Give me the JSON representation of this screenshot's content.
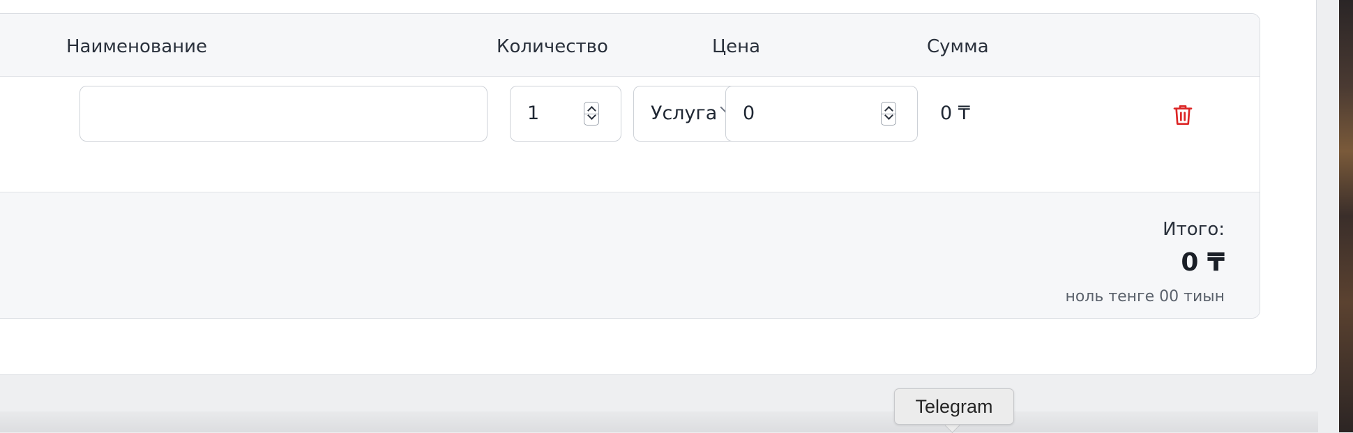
{
  "table": {
    "headers": {
      "name": "Наименование",
      "quantity": "Количество",
      "price": "Цена",
      "sum": "Сумма"
    },
    "rows": [
      {
        "name": "",
        "quantity": "1",
        "unit": "Услуга",
        "price": "0",
        "sum": "0 ₸"
      }
    ]
  },
  "totals": {
    "label": "Итого:",
    "value": "0 ₸",
    "in_words": "ноль тенге 00 тиын"
  },
  "dock": {
    "tooltip": "Telegram"
  },
  "colors": {
    "delete_icon": "#dc2626",
    "header_background": "#f6f7f9",
    "border": "#d9dce1"
  },
  "icons": {
    "delete": "trash-icon",
    "unit_dropdown": "chevron-down-icon",
    "stepper": "stepper-arrows-icon"
  }
}
